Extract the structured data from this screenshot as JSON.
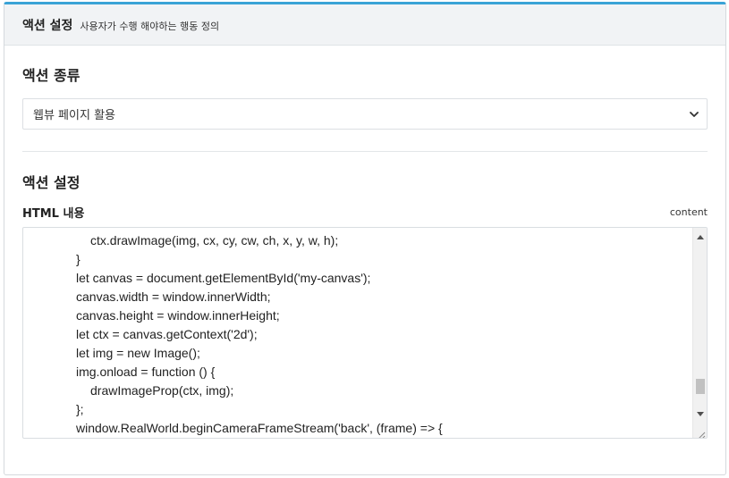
{
  "header": {
    "title": "액션 설정",
    "subtitle": "사용자가 수행 해야하는 행동 정의"
  },
  "action_type": {
    "title": "액션 종류",
    "selected": "웹뷰 페이지 활용",
    "icon": "chevron-down-icon"
  },
  "action_settings": {
    "title": "액션 설정",
    "field_label": "HTML 내용",
    "field_meta": "content"
  },
  "editor": {
    "scroll_position": 0.83,
    "lines": [
      {
        "indent": 2,
        "text": "ctx.drawImage(img, cx, cy, cw, ch, x, y, w, h);"
      },
      {
        "indent": 1,
        "text": "}"
      },
      {
        "indent": 1,
        "text": "let canvas = document.getElementById('my-canvas');"
      },
      {
        "indent": 1,
        "text": "canvas.width = window.innerWidth;"
      },
      {
        "indent": 1,
        "text": "canvas.height = window.innerHeight;"
      },
      {
        "indent": 1,
        "text": "let ctx = canvas.getContext('2d');"
      },
      {
        "indent": 1,
        "text": "let img = new Image();"
      },
      {
        "indent": 1,
        "text": "img.onload = function () {"
      },
      {
        "indent": 2,
        "text": "drawImageProp(ctx, img);"
      },
      {
        "indent": 1,
        "text": "};"
      },
      {
        "indent": 1,
        "text": "window.RealWorld.beginCameraFrameStream('back', (frame) => {"
      }
    ]
  },
  "colors": {
    "accent": "#3aa3d6",
    "header_bg": "#f1f3f5",
    "border": "#d9dde1"
  }
}
